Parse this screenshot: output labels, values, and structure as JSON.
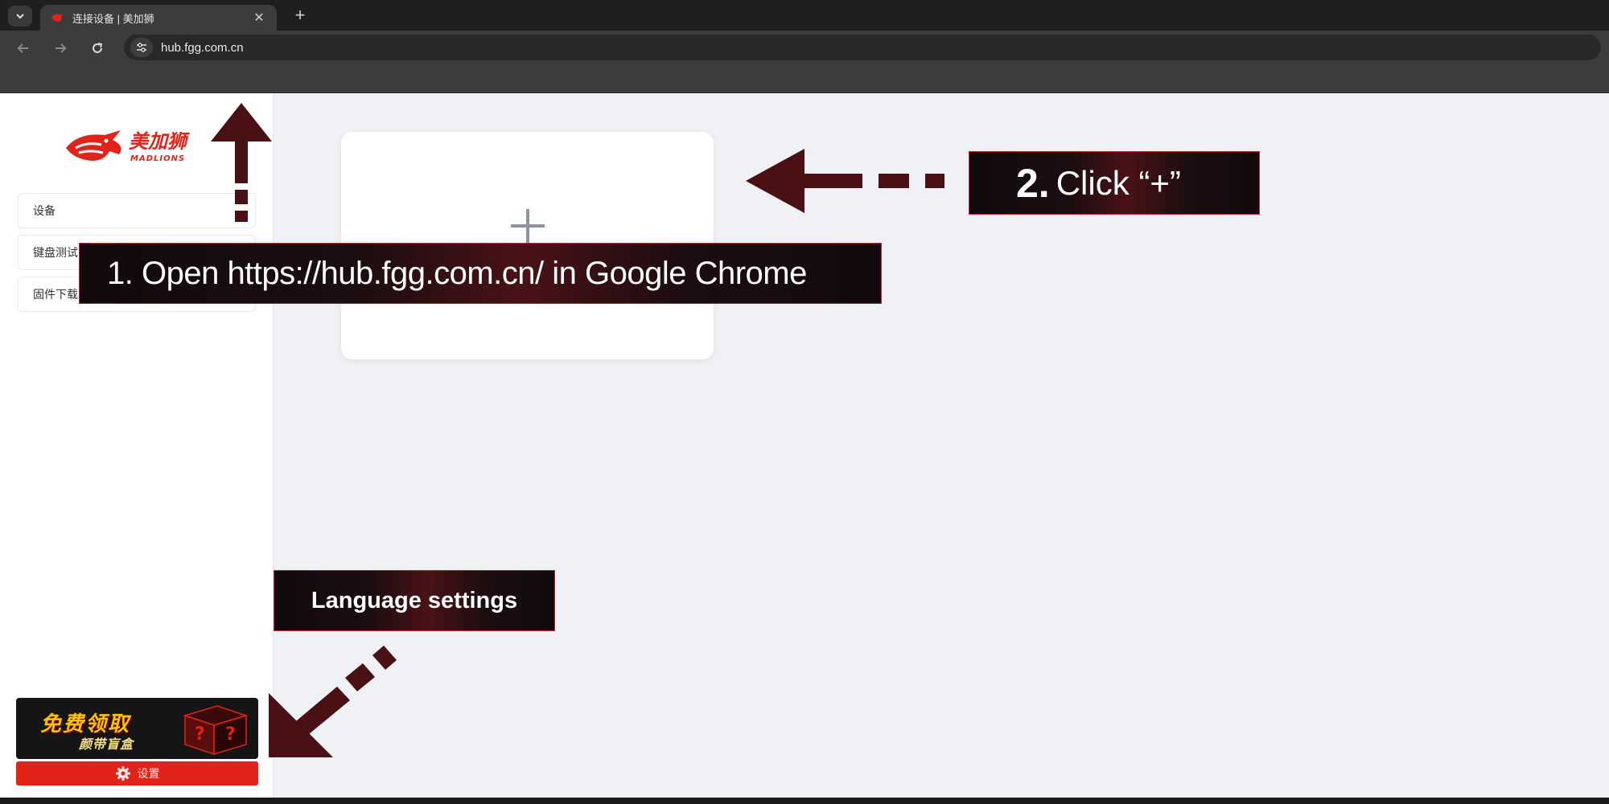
{
  "browser": {
    "tab": {
      "title": "连接设备 | 美加狮",
      "close_glyph": "✕"
    },
    "new_tab_glyph": "+",
    "url": "hub.fgg.com.cn"
  },
  "sidebar": {
    "logo": {
      "brand_cn": "美加狮",
      "brand_en": "MADLIONS"
    },
    "menu_items": [
      {
        "label": "设备"
      },
      {
        "label": "键盘测试"
      },
      {
        "label": "固件下载"
      }
    ],
    "promo": {
      "line1": "免费领取",
      "line2": "颜带盲盒"
    },
    "settings_button": {
      "label": "设置"
    }
  },
  "main": {
    "add_device_card": {
      "glyph": "+"
    }
  },
  "annotations": {
    "step1": "1. Open https://hub.fgg.com.cn/ in Google Chrome",
    "step2_number": "2.",
    "step2_text": "Click  “+”",
    "language": "Language settings"
  },
  "colors": {
    "brand_red": "#e2231a",
    "arrow_dark_red": "#4a1114",
    "callout_border": "#c0263a"
  }
}
